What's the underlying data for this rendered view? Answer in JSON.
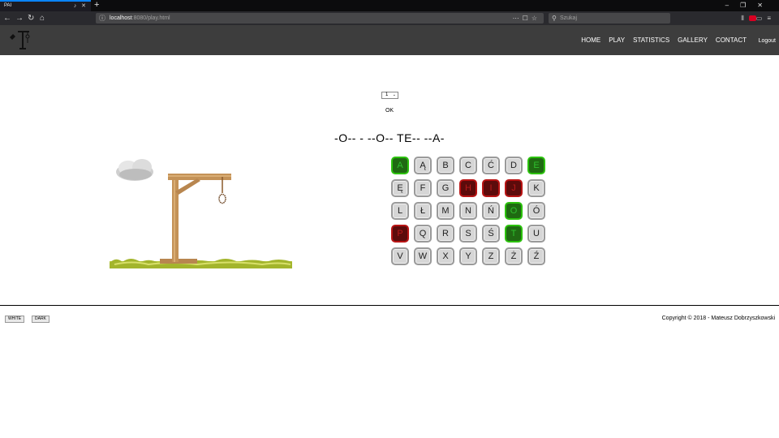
{
  "browser": {
    "tab_title": "PAI",
    "url_host": "localhost",
    "url_rest": ":8080/play.html",
    "search_placeholder": "Szukaj"
  },
  "site": {
    "menu": [
      "HOME",
      "PLAY",
      "STATISTICS",
      "GALLERY",
      "CONTACT"
    ],
    "logout_label": "Logout"
  },
  "game": {
    "select_value": "1",
    "ok_label": "OK",
    "puzzle": "-O-- - --O-- TE-- --A-",
    "letters": [
      {
        "l": "A",
        "s": "hit"
      },
      {
        "l": "Ą",
        "s": "none"
      },
      {
        "l": "B",
        "s": "none"
      },
      {
        "l": "C",
        "s": "none"
      },
      {
        "l": "Ć",
        "s": "none"
      },
      {
        "l": "D",
        "s": "none"
      },
      {
        "l": "E",
        "s": "hit"
      },
      {
        "l": "Ę",
        "s": "none"
      },
      {
        "l": "F",
        "s": "none"
      },
      {
        "l": "G",
        "s": "none"
      },
      {
        "l": "H",
        "s": "miss"
      },
      {
        "l": "I",
        "s": "miss"
      },
      {
        "l": "J",
        "s": "miss"
      },
      {
        "l": "K",
        "s": "none"
      },
      {
        "l": "L",
        "s": "none"
      },
      {
        "l": "Ł",
        "s": "none"
      },
      {
        "l": "M",
        "s": "none"
      },
      {
        "l": "N",
        "s": "none"
      },
      {
        "l": "Ń",
        "s": "none"
      },
      {
        "l": "O",
        "s": "hit"
      },
      {
        "l": "Ó",
        "s": "none"
      },
      {
        "l": "P",
        "s": "miss"
      },
      {
        "l": "Q",
        "s": "none"
      },
      {
        "l": "R",
        "s": "none"
      },
      {
        "l": "S",
        "s": "none"
      },
      {
        "l": "Ś",
        "s": "none"
      },
      {
        "l": "T",
        "s": "hit"
      },
      {
        "l": "U",
        "s": "none"
      },
      {
        "l": "V",
        "s": "none"
      },
      {
        "l": "W",
        "s": "none"
      },
      {
        "l": "X",
        "s": "none"
      },
      {
        "l": "Y",
        "s": "none"
      },
      {
        "l": "Z",
        "s": "none"
      },
      {
        "l": "Ż",
        "s": "none"
      },
      {
        "l": "Ź",
        "s": "none"
      }
    ]
  },
  "footer": {
    "white_label": "WHITE",
    "dark_label": "DARK",
    "copyright": "Copyright © 2018 - Mateusz Dobrzyszkowski"
  },
  "colors": {
    "hit": "#1f6a12",
    "miss": "#5c0b0b",
    "header": "#3d3d3d"
  }
}
